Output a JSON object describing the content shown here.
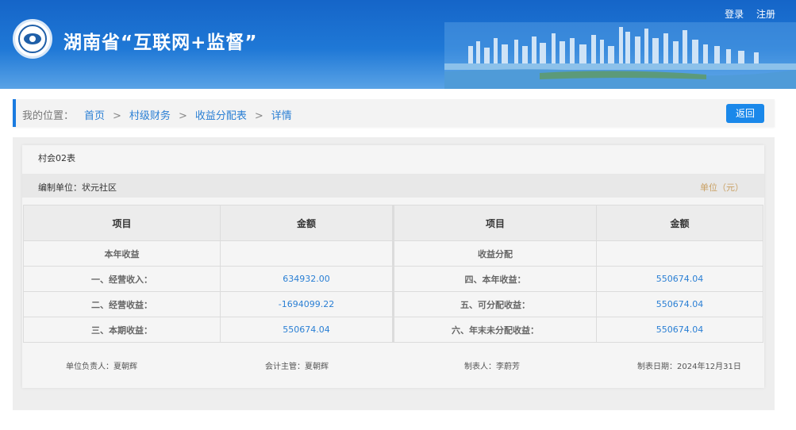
{
  "header": {
    "title": "湖南省“互联网+监督”",
    "login": "登录",
    "register": "注册"
  },
  "breadcrumb": {
    "label": "我的位置：",
    "items": [
      "首页",
      "村级财务",
      "收益分配表",
      "详情"
    ],
    "separator": ">",
    "back_label": "返回"
  },
  "report": {
    "form_no": "村会02表",
    "org_label": "编制单位：",
    "org_name": "状元社区",
    "unit": "单位（元）",
    "headers": [
      "项目",
      "金额",
      "项目",
      "金额"
    ],
    "rows": [
      {
        "l_item": "本年收益",
        "l_amount": "",
        "r_item": "收益分配",
        "r_amount": ""
      },
      {
        "l_item": "一、经营收入：",
        "l_amount": "634932.00",
        "r_item": "四、本年收益：",
        "r_amount": "550674.04"
      },
      {
        "l_item": "二、经营收益：",
        "l_amount": "-1694099.22",
        "r_item": "五、可分配收益：",
        "r_amount": "550674.04"
      },
      {
        "l_item": "三、本期收益：",
        "l_amount": "550674.04",
        "r_item": "六、年末未分配收益：",
        "r_amount": "550674.04"
      }
    ],
    "signatures": {
      "head": "单位负责人：夏朝辉",
      "accountant": "会计主管：夏朝辉",
      "preparer": "制表人：李蔚芳",
      "date": "制表日期：2024年12月31日"
    }
  },
  "colors": {
    "accent": "#1a88ea",
    "link": "#2a7fd4",
    "unit": "#c9a063"
  }
}
